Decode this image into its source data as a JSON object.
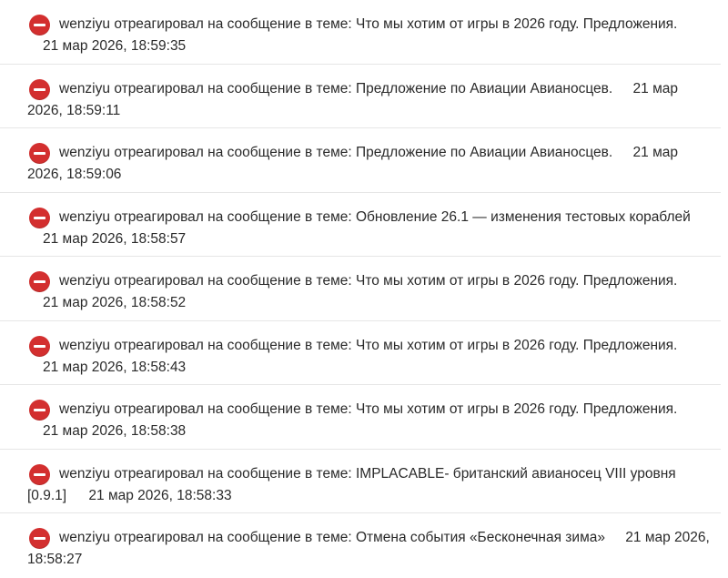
{
  "feed": {
    "items": [
      {
        "user": "wenziyu",
        "action": "отреагировал на сообщение в теме:",
        "topic": "Что мы хотим от игры в 2026 году. Предложения.",
        "time": "21 мар 2026, 18:59:35"
      },
      {
        "user": "wenziyu",
        "action": "отреагировал на сообщение в теме:",
        "topic": "Предложение по Авиации Авианосцев.",
        "time_part1": "21 мар",
        "time_part2": "2026, 18:59:11"
      },
      {
        "user": "wenziyu",
        "action": "отреагировал на сообщение в теме:",
        "topic": "Предложение по Авиации Авианосцев.",
        "time_part1": "21 мар",
        "time_part2": "2026, 18:59:06"
      },
      {
        "user": "wenziyu",
        "action": "отреагировал на сообщение в теме:",
        "topic": "Обновление 26.1 — изменения тестовых кораблей",
        "time": "21 мар 2026, 18:58:57"
      },
      {
        "user": "wenziyu",
        "action": "отреагировал на сообщение в теме:",
        "topic": "Что мы хотим от игры в 2026 году. Предложения.",
        "time": "21 мар 2026, 18:58:52"
      },
      {
        "user": "wenziyu",
        "action": "отреагировал на сообщение в теме:",
        "topic": "Что мы хотим от игры в 2026 году. Предложения.",
        "time": "21 мар 2026, 18:58:43"
      },
      {
        "user": "wenziyu",
        "action": "отреагировал на сообщение в теме:",
        "topic": "Что мы хотим от игры в 2026 году. Предложения.",
        "time": "21 мар 2026, 18:58:38"
      },
      {
        "user": "wenziyu",
        "action": "отреагировал на сообщение в теме:",
        "topic": "IMPLACABLE- британский авианосец VIII уровня",
        "topic_tail": "[0.9.1]",
        "time": "21 мар 2026, 18:58:33"
      },
      {
        "user": "wenziyu",
        "action": "отреагировал на сообщение в теме:",
        "topic": "Отмена события «Бесконечная зима»",
        "time_part1": "21 мар 2026,",
        "time_part2": "18:58:27"
      }
    ]
  }
}
